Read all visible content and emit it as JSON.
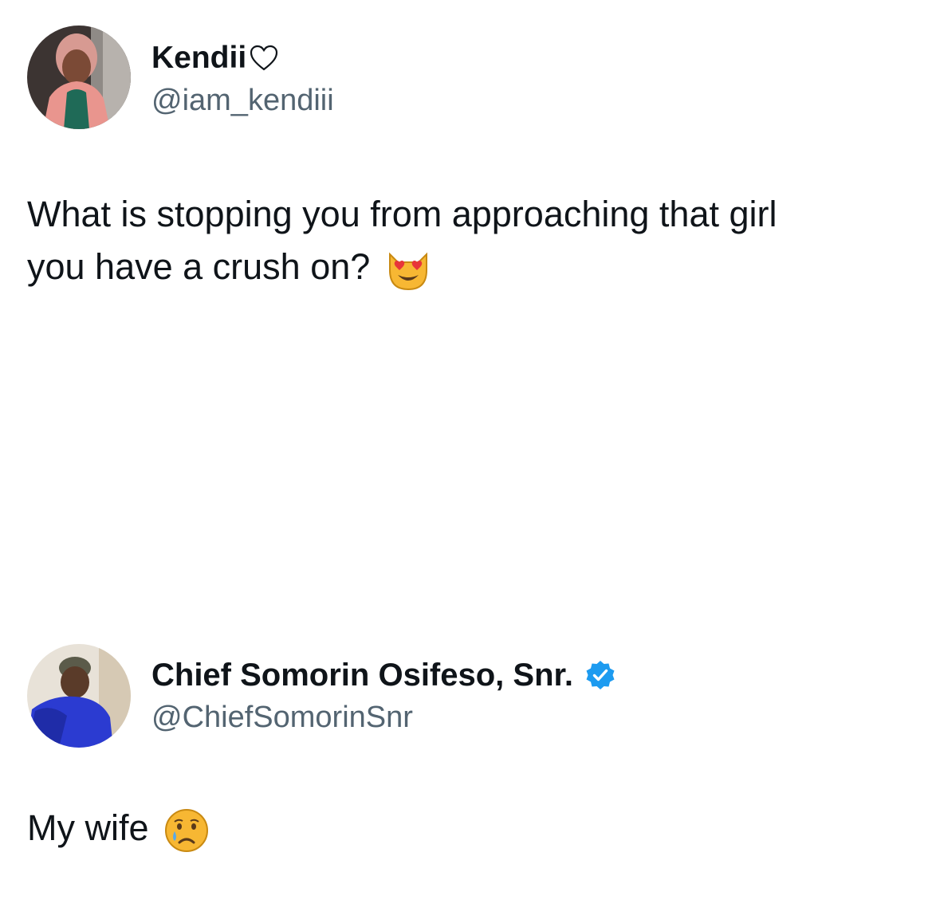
{
  "tweets": [
    {
      "display_name": "Kendii",
      "name_suffix_icon": "heart-outline-icon",
      "handle": "@iam_kendiii",
      "text_line_1": "What is stopping you from approaching that girl",
      "text_line_2": "you have a crush on?",
      "emoji": "smiling-cat-heart-eyes-icon",
      "avatar": "woman-in-pink-blazer-avatar"
    },
    {
      "display_name": "Chief Somorin Osifeso, Snr.",
      "verified": true,
      "verified_color": "#1d9bf0",
      "handle": "@ChiefSomorinSnr",
      "text": "My wife",
      "emoji": "crying-face-icon",
      "avatar": "man-in-blue-agbada-avatar"
    }
  ],
  "colors": {
    "text": "#0f1419",
    "handle": "#536471",
    "verified": "#1d9bf0"
  }
}
